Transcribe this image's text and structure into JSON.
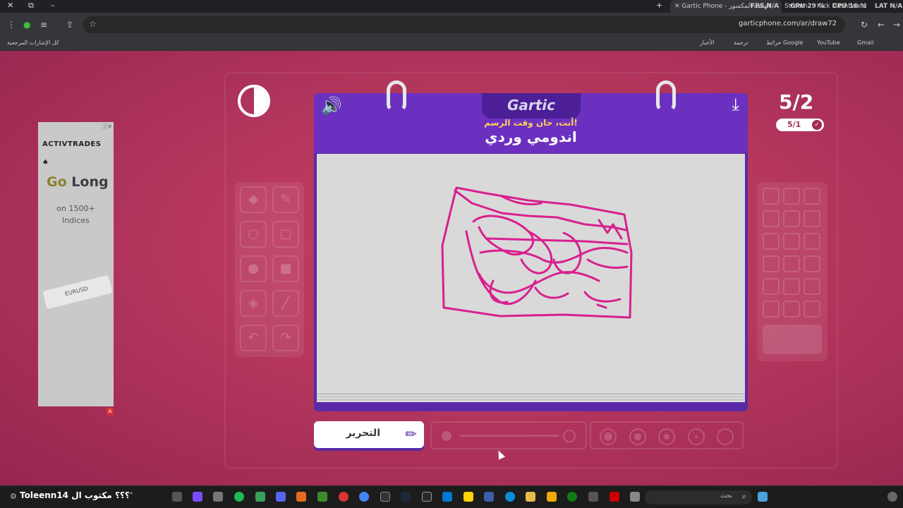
{
  "browser": {
    "tab_title": "Gartic Phone - الهاتف المكسور",
    "tab_other_1": "Stream",
    "tab_other_2": "Kick Dashboard",
    "perf": {
      "fps": "FPS N/A",
      "gpu": "GPU 29 %",
      "cpu": "CPU 16 %",
      "lat": "LAT N/A"
    },
    "url": "garticphone.com/ar/draw72",
    "bookmarks": {
      "all_label": "كل الإشارات المرجعية",
      "news": "الأخبار",
      "translate": "ترجمة",
      "maps": "خرائط Google",
      "youtube": "YouTube",
      "gmail": "Gmail"
    }
  },
  "ad": {
    "brand": "ACTIVTRADES",
    "headline_1": "Go",
    "headline_2": "Long",
    "line_1": "on 1500+",
    "line_2": "Indices",
    "card": "EURUSD",
    "badge": "A"
  },
  "game": {
    "logo": "Gartic",
    "subtitle": "أنت، حان وقت الرسم!",
    "word": "اندومي وردي",
    "round": "5/2",
    "progress": "5/1",
    "edit_label": "التحرير",
    "drawing_color": "#d8208e"
  },
  "taskbar": {
    "user": "Toleenn14 ؟؟؟ مكتوب ال",
    "search_placeholder": "بحث"
  }
}
